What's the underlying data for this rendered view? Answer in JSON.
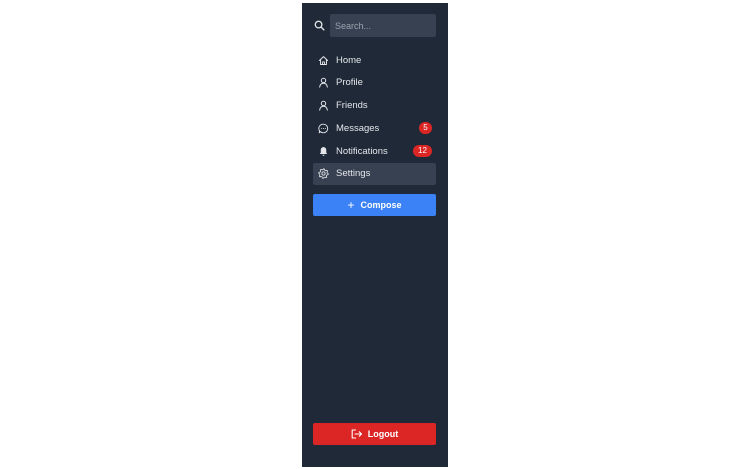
{
  "colors": {
    "sidebar_bg": "#1f2937",
    "active_bg": "#374151",
    "accent": "#3b82f6",
    "danger": "#dc2626",
    "badge": "#dc2626",
    "text": "#e5e7eb"
  },
  "search": {
    "placeholder": "Search...",
    "value": "",
    "icon": "search-icon"
  },
  "nav": {
    "items": [
      {
        "label": "Home",
        "icon": "home-icon",
        "active": false
      },
      {
        "label": "Profile",
        "icon": "user-icon",
        "active": false
      },
      {
        "label": "Friends",
        "icon": "user-icon",
        "active": false
      },
      {
        "label": "Messages",
        "icon": "chat-icon",
        "badge": "5",
        "active": false
      },
      {
        "label": "Notifications",
        "icon": "bell-icon",
        "badge": "12",
        "active": false
      },
      {
        "label": "Settings",
        "icon": "gear-icon",
        "active": true
      }
    ]
  },
  "compose": {
    "label": "Compose",
    "icon": "plus-icon"
  },
  "logout": {
    "label": "Logout",
    "icon": "logout-icon"
  }
}
